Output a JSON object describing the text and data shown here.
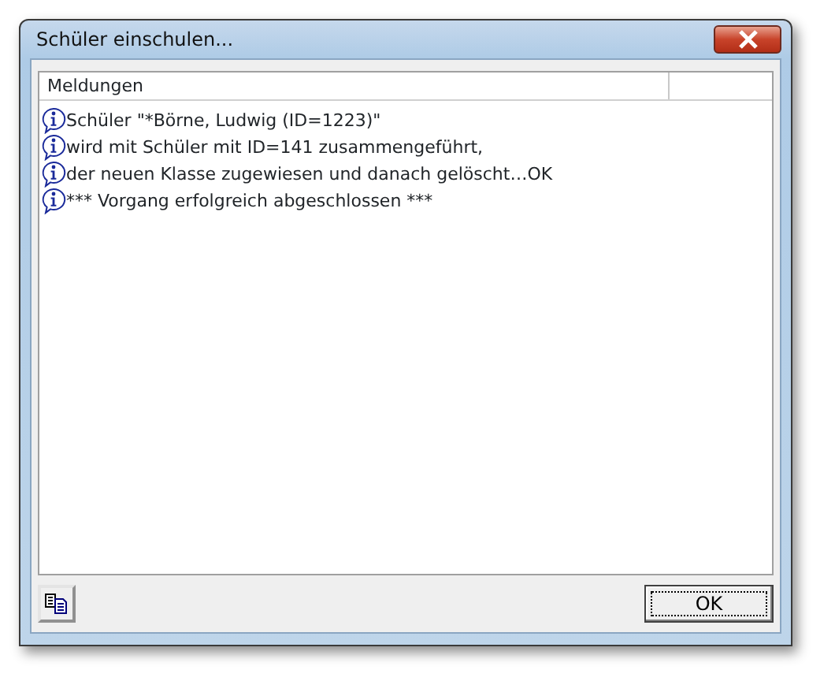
{
  "window": {
    "title": "Schüler einschulen..."
  },
  "list": {
    "columns": [
      "Meldungen"
    ],
    "rows": [
      {
        "text": "Schüler \"*Börne, Ludwig (ID=1223)\""
      },
      {
        "text": "wird mit Schüler mit ID=141 zusammengeführt,"
      },
      {
        "text": "der neuen Klasse zugewiesen und danach gelöscht…OK"
      },
      {
        "text": "*** Vorgang erfolgreich abgeschlossen ***"
      }
    ]
  },
  "buttons": [
    {
      "label": "OK"
    }
  ]
}
